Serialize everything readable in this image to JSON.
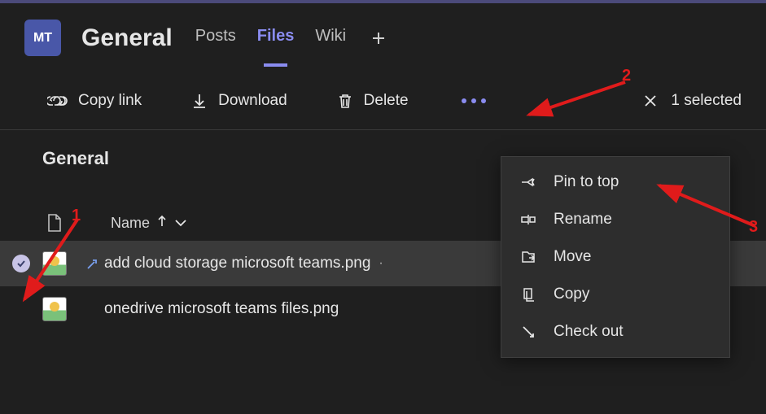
{
  "header": {
    "team_abbr": "MT",
    "channel": "General",
    "tabs": [
      "Posts",
      "Files",
      "Wiki"
    ],
    "active_tab": "Files"
  },
  "toolbar": {
    "copy_link": "Copy link",
    "download": "Download",
    "delete": "Delete",
    "selected_count": "1 selected"
  },
  "files": {
    "section": "General",
    "name_col": "Name",
    "rows": [
      {
        "name": "add cloud storage microsoft teams.png",
        "selected": true,
        "shared": true
      },
      {
        "name": "onedrive microsoft teams files.png",
        "selected": false,
        "shared": false
      }
    ]
  },
  "menu": {
    "items": [
      {
        "icon": "pin",
        "label": "Pin to top"
      },
      {
        "icon": "rename",
        "label": "Rename"
      },
      {
        "icon": "move",
        "label": "Move"
      },
      {
        "icon": "copy",
        "label": "Copy"
      },
      {
        "icon": "checkout",
        "label": "Check out"
      }
    ]
  },
  "annotations": {
    "a1": "1",
    "a2": "2",
    "a3": "3"
  }
}
